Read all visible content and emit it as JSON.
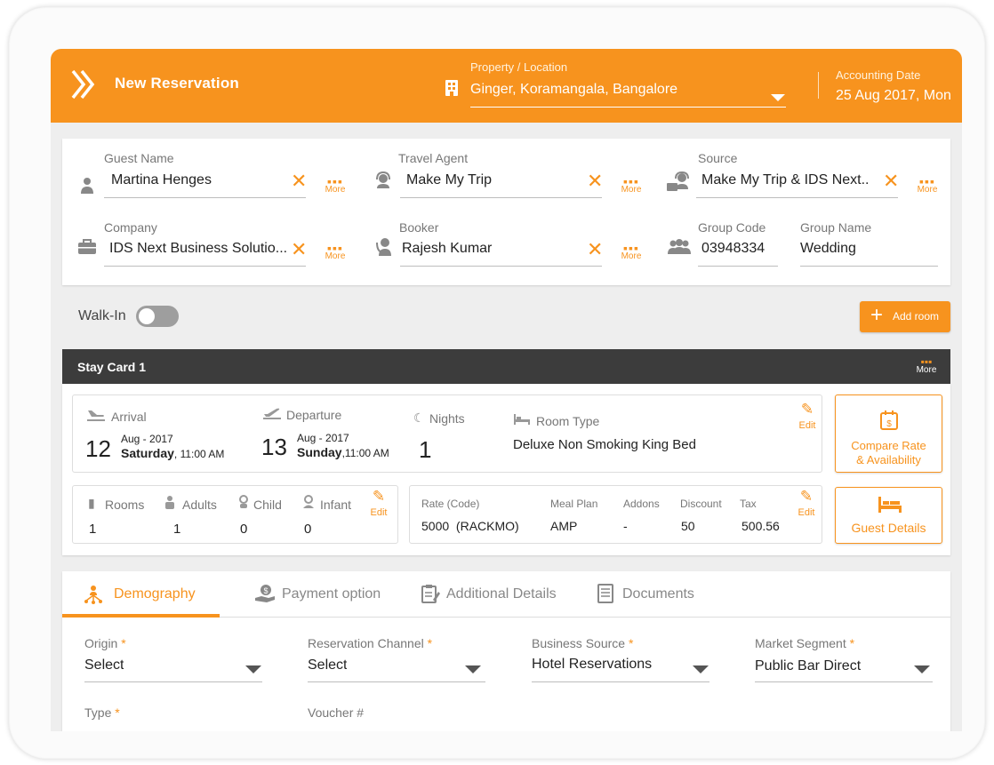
{
  "header": {
    "title": "New Reservation",
    "property_label": "Property / Location",
    "property_value": "Ginger, Koramangala, Bangalore",
    "accounting_label": "Accounting Date",
    "accounting_value": "25 Aug 2017, Mon"
  },
  "guest": {
    "guest_name_label": "Guest Name",
    "guest_name_value": "Martina Henges",
    "travel_agent_label": "Travel Agent",
    "travel_agent_value": "Make My Trip",
    "source_label": "Source",
    "source_value": "Make My Trip & IDS Next..",
    "company_label": "Company",
    "company_value": "IDS Next Business Solutio...",
    "booker_label": "Booker",
    "booker_value": "Rajesh Kumar",
    "group_code_label": "Group Code",
    "group_code_value": "03948334",
    "group_name_label": "Group Name",
    "group_name_value": "Wedding",
    "more_label": "More"
  },
  "walkin": {
    "label": "Walk-In",
    "enabled": false
  },
  "add_room_label": "Add room",
  "stay_card": {
    "title": "Stay Card 1",
    "more_label": "More",
    "arrival_label": "Arrival",
    "arrival_day": "12",
    "arrival_month": "Aug - 2017",
    "arrival_weekday": "Saturday",
    "arrival_time": ", 11:00 AM",
    "departure_label": "Departure",
    "departure_day": "13",
    "departure_month": "Aug - 2017",
    "departure_weekday": "Sunday",
    "departure_time": ",11:00 AM",
    "nights_label": "Nights",
    "nights_value": "1",
    "room_type_label": "Room Type",
    "room_type_value": "Deluxe Non Smoking King Bed",
    "edit_label": "Edit",
    "rooms_label": "Rooms",
    "rooms_value": "1",
    "adults_label": "Adults",
    "adults_value": "1",
    "child_label": "Child",
    "child_value": "0",
    "infant_label": "Infant",
    "infant_value": "0",
    "rate_label": "Rate (Code)",
    "rate_value": "5000  (RACKMO)",
    "meal_label": "Meal Plan",
    "meal_value": "AMP",
    "addons_label": "Addons",
    "addons_value": "-",
    "discount_label": "Discount",
    "discount_value": "50",
    "tax_label": "Tax",
    "tax_value": "500.56",
    "compare_label_1": "Compare Rate",
    "compare_label_2": "& Availability",
    "guest_details_label": "Guest Details"
  },
  "tabs": [
    {
      "label": "Demography",
      "active": true
    },
    {
      "label": "Payment option",
      "active": false
    },
    {
      "label": "Additional Details",
      "active": false
    },
    {
      "label": "Documents",
      "active": false
    }
  ],
  "demography": {
    "origin_label": "Origin",
    "origin_value": "Select",
    "channel_label": "Reservation Channel",
    "channel_value": "Select",
    "business_label": "Business Source",
    "business_value": "Hotel Reservations",
    "market_label": "Market Segment",
    "market_value": "Public Bar Direct",
    "type_label": "Type",
    "voucher_label": "Voucher #",
    "required_mark": "*"
  },
  "colors": {
    "accent": "#f7931e",
    "stay_header": "#3c3c3c",
    "background": "#eeeeee"
  }
}
